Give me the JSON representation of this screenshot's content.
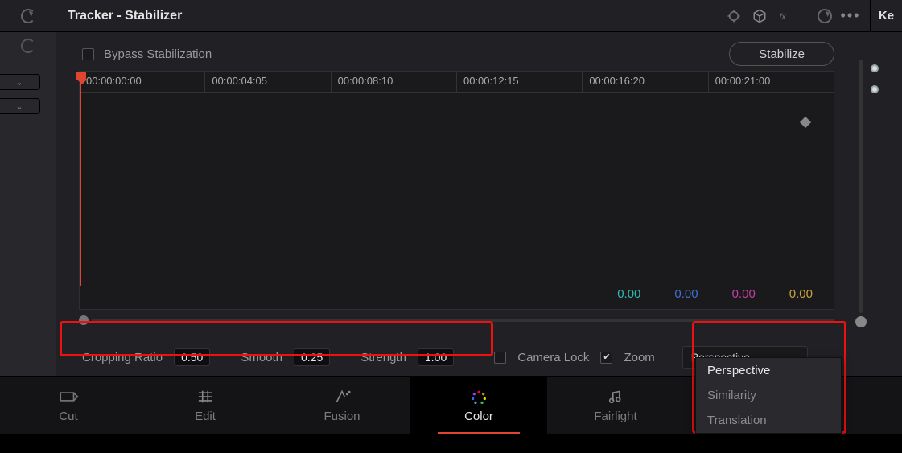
{
  "header": {
    "title": "Tracker - Stabilizer",
    "right_label": "Ke"
  },
  "bypass": {
    "label": "Bypass Stabilization",
    "checked": false,
    "button": "Stabilize"
  },
  "timeline": {
    "ticks": [
      "00:00:00:00",
      "00:00:04:05",
      "00:00:08:10",
      "00:00:12:15",
      "00:00:16:20",
      "00:00:21:00"
    ],
    "readouts": [
      "0.00",
      "0.00",
      "0.00",
      "0.00"
    ]
  },
  "params": {
    "cropping_label": "Cropping Ratio",
    "cropping_value": "0.50",
    "smooth_label": "Smooth",
    "smooth_value": "0.25",
    "strength_label": "Strength",
    "strength_value": "1.00",
    "camera_lock_label": "Camera Lock",
    "camera_lock_checked": false,
    "zoom_label": "Zoom",
    "zoom_checked": true
  },
  "mode": {
    "selected": "Perspective",
    "options": [
      "Perspective",
      "Similarity",
      "Translation"
    ]
  },
  "pages": {
    "items": [
      {
        "label": "Cut"
      },
      {
        "label": "Edit"
      },
      {
        "label": "Fusion"
      },
      {
        "label": "Color"
      },
      {
        "label": "Fairlight"
      }
    ],
    "active": 3
  }
}
